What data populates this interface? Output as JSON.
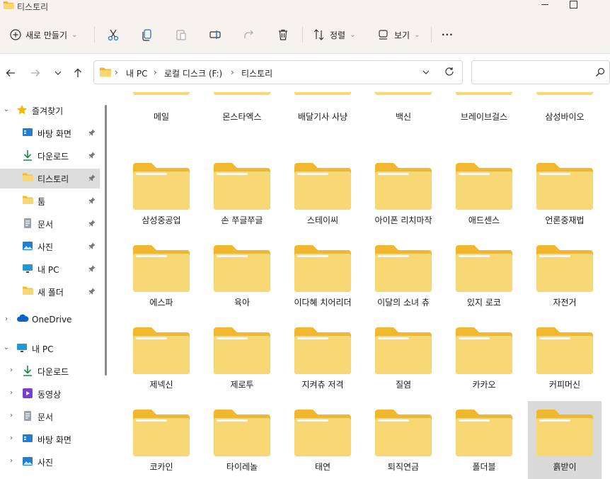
{
  "window": {
    "title": "티스토리"
  },
  "toolbar": {
    "new_label": "새로 만들기",
    "sort_label": "정렬",
    "view_label": "보기",
    "more_label": "···"
  },
  "address": {
    "crumbs": [
      "내 PC",
      "로컬 디스크 (F:)",
      "티스토리"
    ],
    "search_placeholder": ""
  },
  "sidebar": {
    "items": [
      {
        "label": "즐겨찾기",
        "icon": "star-icon",
        "level": 0,
        "expanded": true
      },
      {
        "label": "바탕 화면",
        "icon": "desktop-icon",
        "level": 1,
        "pinned": true
      },
      {
        "label": "다운로드",
        "icon": "download-icon",
        "level": 1,
        "pinned": true
      },
      {
        "label": "티스토리",
        "icon": "folder-icon",
        "level": 1,
        "pinned": true,
        "active": true
      },
      {
        "label": "툼",
        "icon": "folder-icon",
        "level": 1,
        "pinned": true
      },
      {
        "label": "문서",
        "icon": "document-icon",
        "level": 1,
        "pinned": true
      },
      {
        "label": "사진",
        "icon": "pictures-icon",
        "level": 1,
        "pinned": true
      },
      {
        "label": "내 PC",
        "icon": "pc-icon",
        "level": 1,
        "pinned": true
      },
      {
        "label": "새 폴더",
        "icon": "folder-icon",
        "level": 1,
        "pinned": true
      },
      {
        "label": "OneDrive",
        "icon": "cloud-icon",
        "level": 0,
        "expanded": false
      },
      {
        "label": "내 PC",
        "icon": "pc-icon",
        "level": 0,
        "expanded": true
      },
      {
        "label": "다운로드",
        "icon": "download-icon",
        "level": 1,
        "expandable": true
      },
      {
        "label": "동영상",
        "icon": "video-icon",
        "level": 1,
        "expandable": true
      },
      {
        "label": "문서",
        "icon": "document-icon",
        "level": 1,
        "expandable": true
      },
      {
        "label": "바탕 화면",
        "icon": "desktop-icon",
        "level": 1,
        "expandable": true
      },
      {
        "label": "사진",
        "icon": "pictures-icon",
        "level": 1,
        "expandable": true
      }
    ]
  },
  "folders": [
    "메일",
    "몬스타엑스",
    "배달기사 사냥",
    "백신",
    "브레이브걸스",
    "삼성바이오",
    "삼성중공업",
    "손 쭈글쭈글",
    "스테이씨",
    "아이폰 리치마작",
    "애드센스",
    "언론중재법",
    "에스파",
    "육아",
    "이다혜 치어리더",
    "이달의 소녀 츄",
    "있지 로코",
    "자전거",
    "제넥신",
    "제로투",
    "지켜츄 저격",
    "질염",
    "카카오",
    "커피머신",
    "코카인",
    "타이레놀",
    "태연",
    "퇴직연금",
    "폴더블",
    "흙받이"
  ],
  "selected_folder": "흙받이",
  "colors": {
    "folder_main": "#f8d775",
    "folder_back": "#f0b72f",
    "accent": "#0067c0"
  }
}
